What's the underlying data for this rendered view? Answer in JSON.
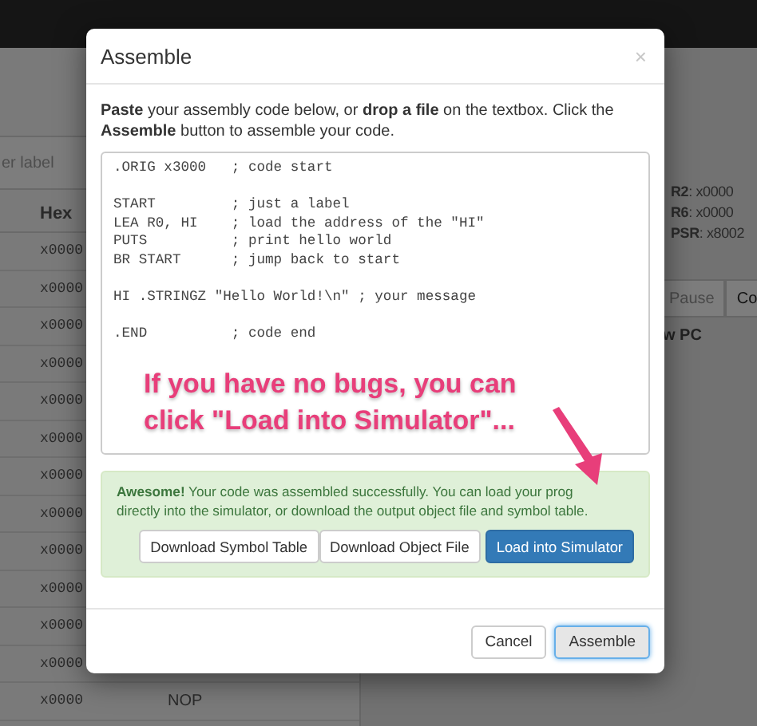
{
  "background": {
    "filter_placeholder": "er label",
    "table": {
      "columns": [
        "Hex"
      ],
      "rows": [
        {
          "hex": "x0000"
        },
        {
          "hex": "x0000"
        },
        {
          "hex": "x0000"
        },
        {
          "hex": "x0000"
        },
        {
          "hex": "x0000"
        },
        {
          "hex": "x0000"
        },
        {
          "hex": "x0000"
        },
        {
          "hex": "x0000"
        },
        {
          "hex": "x0000"
        },
        {
          "hex": "x0000"
        },
        {
          "hex": "x0000"
        },
        {
          "hex": "x0000"
        },
        {
          "hex": "x0000",
          "instruction": "NOP"
        }
      ]
    },
    "registers": [
      "**R2**: x0000",
      "**R6**: x0000",
      "**PSR**: x8002"
    ],
    "controls": [
      "Pause",
      "Co"
    ],
    "note": "w PC"
  },
  "dialog": {
    "title": "Assemble",
    "close": "×",
    "instructions": "**Paste** your assembly code below, or **drop a file** on the textbox. Click the **Assemble** button to assemble your code.",
    "code": [
      [
        ".ORIG x3000   ; code start"
      ],
      [
        "START         ; just a label",
        "LEA R0, HI    ; load the address of the \"HI\"",
        "PUTS          ; print hello world",
        "BR START      ; jump back to start"
      ],
      [
        "HI .STRINGZ \"Hello World!\\n\" ; your message"
      ],
      [
        ".END          ; code end"
      ]
    ],
    "success": [
      "**Awesome!** Your code was assembled successfully. You can load your prog",
      "directly into the simulator, or download the output object file and symbol table."
    ],
    "actions": [
      {
        "label": "Download Symbol Table",
        "kind": "default"
      },
      {
        "label": "Download Object File",
        "kind": "default"
      },
      {
        "label": "Load into Simulator",
        "kind": "primary"
      }
    ],
    "footer": [
      {
        "label": "Cancel",
        "kind": "default"
      },
      {
        "label": "Assemble",
        "kind": "focused"
      }
    ]
  },
  "annotation": "If you have no bugs, you can click \"Load into Simulator\"..."
}
